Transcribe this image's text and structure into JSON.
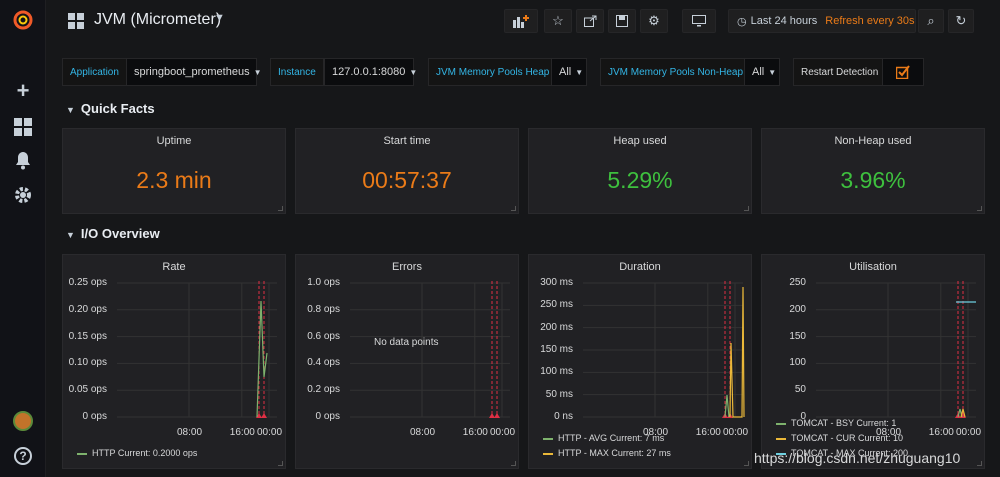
{
  "dashboard": {
    "title": "JVM (Micrometer)"
  },
  "timepicker": {
    "range": "Last 24 hours",
    "refresh": "Refresh every 30s"
  },
  "variables": [
    {
      "label": "Application",
      "value": "springboot_prometheus"
    },
    {
      "label": "Instance",
      "value": "127.0.0.1:8080"
    },
    {
      "label": "JVM Memory Pools Heap",
      "value": "All"
    },
    {
      "label": "JVM Memory Pools Non-Heap",
      "value": "All"
    },
    {
      "label": "Restart Detection"
    }
  ],
  "rows": [
    {
      "title": "Quick Facts"
    },
    {
      "title": "I/O Overview"
    }
  ],
  "stats": [
    {
      "title": "Uptime",
      "value": "2.3 min",
      "color": "#eb7b18"
    },
    {
      "title": "Start time",
      "value": "00:57:37",
      "color": "#eb7b18"
    },
    {
      "title": "Heap used",
      "value": "5.29%",
      "color": "#3ec03e"
    },
    {
      "title": "Non-Heap used",
      "value": "3.96%",
      "color": "#3ec03e"
    }
  ],
  "chart_data": [
    {
      "type": "line",
      "title": "Rate",
      "y_ticks": [
        "0.25 ops",
        "0.20 ops",
        "0.15 ops",
        "0.10 ops",
        "0.05 ops",
        "0 ops"
      ],
      "x_ticks": [
        "08:00",
        "16:00",
        "00:00"
      ],
      "ylim": [
        0,
        0.25
      ],
      "series": [
        {
          "name": "HTTP",
          "current": "Current: 0.2000 ops",
          "color": "#7eb26d"
        }
      ]
    },
    {
      "type": "line",
      "title": "Errors",
      "y_ticks": [
        "1.0 ops",
        "0.8 ops",
        "0.6 ops",
        "0.4 ops",
        "0.2 ops",
        "0 ops"
      ],
      "x_ticks": [
        "08:00",
        "16:00",
        "00:00"
      ],
      "ylim": [
        0,
        1.0
      ],
      "no_data": "No data points",
      "series": []
    },
    {
      "type": "line",
      "title": "Duration",
      "y_ticks": [
        "300 ms",
        "250 ms",
        "200 ms",
        "150 ms",
        "100 ms",
        "50 ms",
        "0 ns"
      ],
      "x_ticks": [
        "08:00",
        "16:00",
        "00:00"
      ],
      "ylim": [
        0,
        300
      ],
      "series": [
        {
          "name": "HTTP - AVG",
          "current": "Current: 7 ms",
          "color": "#7eb26d"
        },
        {
          "name": "HTTP - MAX",
          "current": "Current: 27 ms",
          "color": "#eab839"
        }
      ]
    },
    {
      "type": "line",
      "title": "Utilisation",
      "y_ticks": [
        "250",
        "200",
        "150",
        "100",
        "50",
        "0"
      ],
      "x_ticks": [
        "08:00",
        "16:00",
        "00:00"
      ],
      "ylim": [
        0,
        250
      ],
      "series": [
        {
          "name": "TOMCAT - BSY",
          "current": "Current: 1",
          "color": "#7eb26d"
        },
        {
          "name": "TOMCAT - CUR",
          "current": "Current: 10",
          "color": "#eab839"
        },
        {
          "name": "TOMCAT - MAX",
          "current": "Current: 200",
          "color": "#6ed0e0"
        }
      ]
    }
  ],
  "watermark": "https://blog.csdn.net/zhuguang10"
}
